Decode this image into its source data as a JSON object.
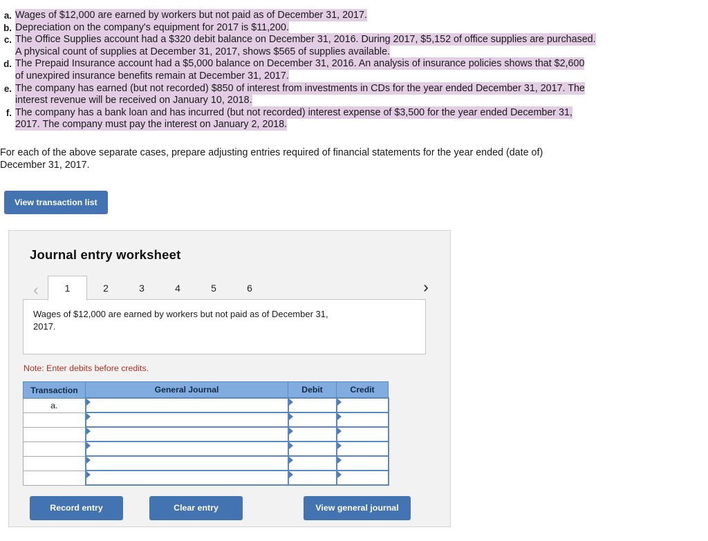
{
  "cases": [
    {
      "letter": "a.",
      "lines": [
        {
          "text": "Wages of $12,000 are earned by workers but not paid as of December 31, 2017.",
          "highlight": true
        }
      ]
    },
    {
      "letter": "b.",
      "lines": [
        {
          "text": "Depreciation on the company's equipment for 2017 is $11,200.",
          "highlight": true
        }
      ]
    },
    {
      "letter": "c.",
      "lines": [
        {
          "text": "The Office Supplies account had a $320 debit balance on December 31, 2016. During 2017, $5,152 of office supplies are purchased.",
          "highlight": true
        },
        {
          "text": "A physical count of supplies at December 31, 2017, shows $565 of supplies available.",
          "highlight": true
        }
      ]
    },
    {
      "letter": "d.",
      "lines": [
        {
          "text": "The Prepaid Insurance account had a $5,000 balance on December 31, 2016. An analysis of insurance policies shows that $2,600",
          "highlight": true
        },
        {
          "text": "of unexpired insurance benefits remain at December 31, 2017.",
          "highlight": true
        }
      ]
    },
    {
      "letter": "e.",
      "lines": [
        {
          "text": "The company has earned (but not recorded) $850 of interest from investments in CDs for the year ended December 31, 2017. The",
          "highlight": true
        },
        {
          "text": "interest revenue will be received on January 10, 2018.",
          "highlight": true
        }
      ]
    },
    {
      "letter": "f.",
      "lines": [
        {
          "text": "The company has a bank loan and has incurred (but not recorded) interest expense of $3,500 for the year ended December 31,",
          "highlight": true
        },
        {
          "text": "2017. The company must pay the interest on January 2, 2018.",
          "highlight": true
        }
      ]
    }
  ],
  "instructions": {
    "line1": "For each of the above separate cases, prepare adjusting entries required of financial statements for the year ended (date of)",
    "line2": "December 31, 2017."
  },
  "view_transaction_button": "View transaction list",
  "worksheet": {
    "title": "Journal entry worksheet",
    "prev_icon": "chevron-left-icon",
    "next_icon": "chevron-right-icon",
    "prev_glyph": "‹",
    "next_glyph": "›",
    "tabs": [
      "1",
      "2",
      "3",
      "4",
      "5",
      "6"
    ],
    "active_tab": "1",
    "description": {
      "line1": "Wages of $12,000 are earned by workers but not paid as of December 31,",
      "line2": "2017."
    },
    "note": "Note: Enter debits before credits.",
    "table": {
      "headers": [
        "Transaction",
        "General Journal",
        "Debit",
        "Credit"
      ],
      "rows": [
        {
          "transaction": "a.",
          "general_journal": "",
          "debit": "",
          "credit": ""
        },
        {
          "transaction": "",
          "general_journal": "",
          "debit": "",
          "credit": ""
        },
        {
          "transaction": "",
          "general_journal": "",
          "debit": "",
          "credit": ""
        },
        {
          "transaction": "",
          "general_journal": "",
          "debit": "",
          "credit": ""
        },
        {
          "transaction": "",
          "general_journal": "",
          "debit": "",
          "credit": ""
        },
        {
          "transaction": "",
          "general_journal": "",
          "debit": "",
          "credit": ""
        }
      ]
    },
    "buttons": {
      "record": "Record entry",
      "clear": "Clear entry",
      "view_journal": "View general journal"
    }
  },
  "colors": {
    "button_blue": "#4373b0",
    "table_header_blue": "#80ace0",
    "cell_border_blue": "#5b88c4",
    "highlight": "#e3cde4",
    "note_red": "#b03020",
    "panel_bg": "#f2f2f2"
  }
}
